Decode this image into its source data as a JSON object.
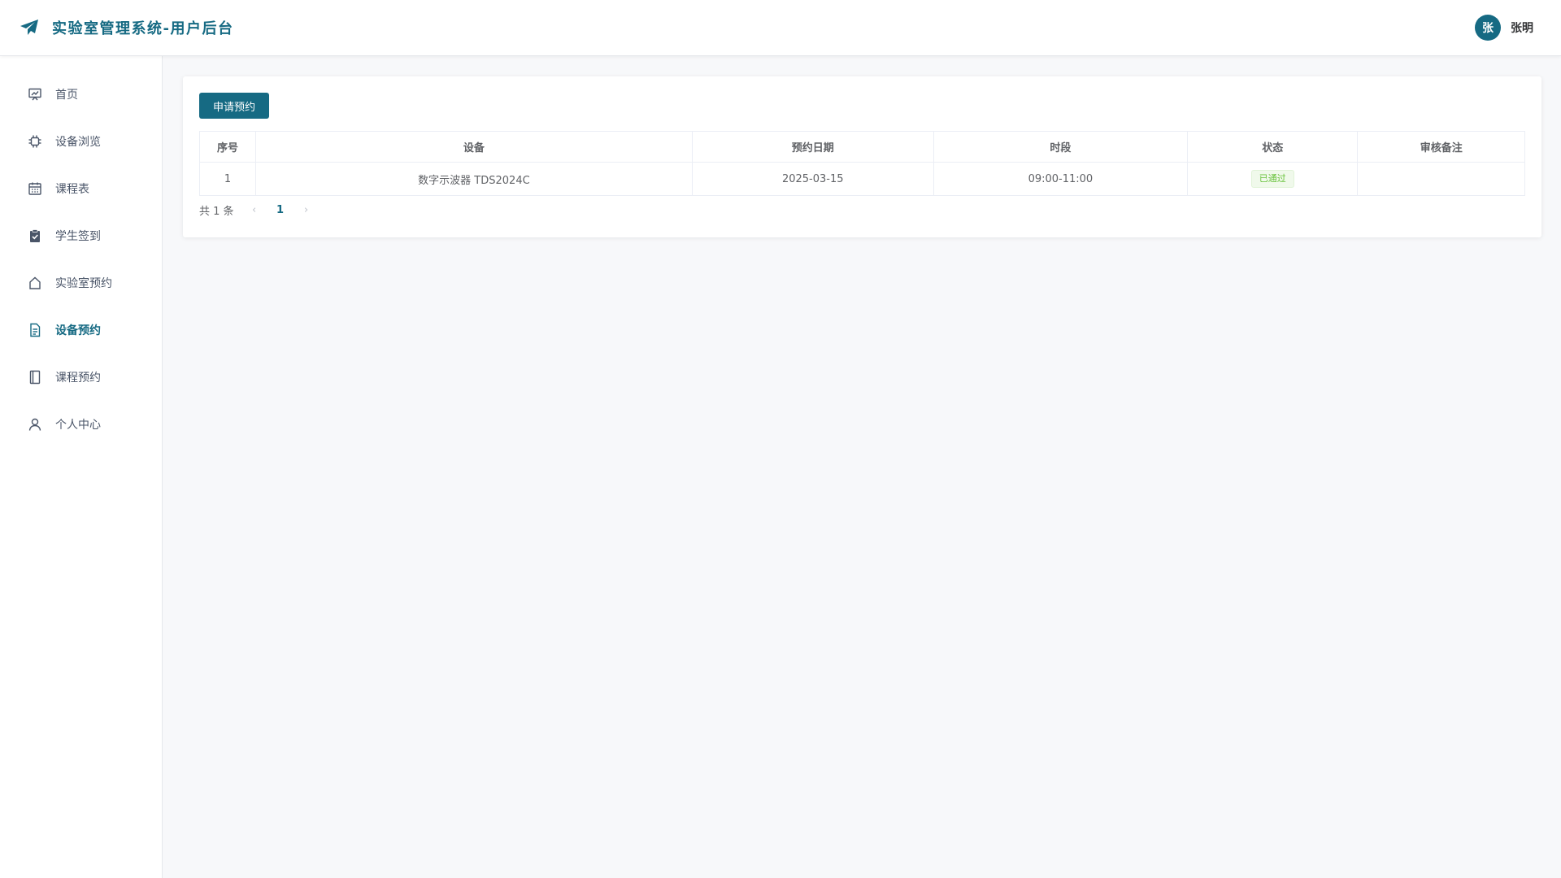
{
  "header": {
    "title": "实验室管理系统-用户后台",
    "logo_icon": "paper-plane-icon",
    "avatar_text": "张",
    "username": "张明",
    "brand_color": "#166a83"
  },
  "sidebar": {
    "items": [
      {
        "label": "首页",
        "icon": "presentation-chart-icon",
        "active": false
      },
      {
        "label": "设备浏览",
        "icon": "chip-icon",
        "active": false
      },
      {
        "label": "课程表",
        "icon": "calendar-icon",
        "active": false
      },
      {
        "label": "学生签到",
        "icon": "clipboard-check-icon",
        "active": false
      },
      {
        "label": "实验室预约",
        "icon": "house-icon",
        "active": false
      },
      {
        "label": "设备预约",
        "icon": "document-icon",
        "active": true
      },
      {
        "label": "课程预约",
        "icon": "notebook-icon",
        "active": false
      },
      {
        "label": "个人中心",
        "icon": "user-icon",
        "active": false
      }
    ]
  },
  "main": {
    "apply_button": "申请预约",
    "table": {
      "columns": [
        "序号",
        "设备",
        "预约日期",
        "时段",
        "状态",
        "审核备注"
      ],
      "rows": [
        {
          "index": "1",
          "device": "数字示波器 TDS2024C",
          "date": "2025-03-15",
          "slot": "09:00-11:00",
          "status": "已通过",
          "remark": ""
        }
      ]
    },
    "pagination": {
      "total_text": "共 1 条",
      "current_page": "1",
      "prev_icon": "chevron-left-icon",
      "next_icon": "chevron-right-icon"
    }
  }
}
